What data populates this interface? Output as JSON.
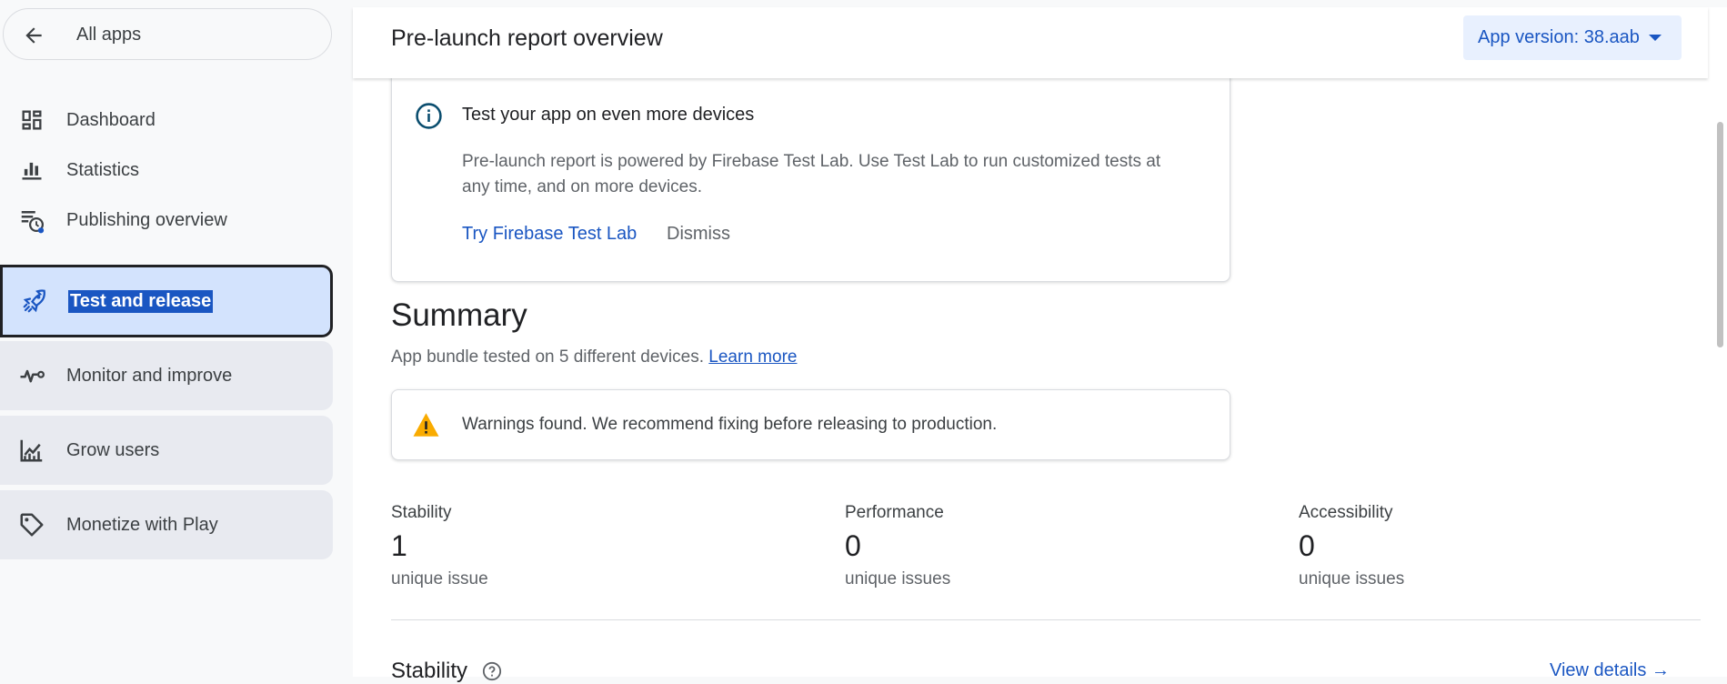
{
  "sidebar": {
    "back_label": "All apps",
    "items": [
      {
        "label": "Dashboard",
        "icon": "dashboard-icon"
      },
      {
        "label": "Statistics",
        "icon": "bar-chart-icon"
      },
      {
        "label": "Publishing overview",
        "icon": "publishing-overview-icon"
      },
      {
        "label": "Test and release",
        "icon": "rocket-icon",
        "active": true
      },
      {
        "label": "Monitor and improve",
        "icon": "vitals-icon"
      },
      {
        "label": "Grow users",
        "icon": "grow-users-icon"
      },
      {
        "label": "Monetize with Play",
        "icon": "tag-icon"
      }
    ]
  },
  "header": {
    "title": "Pre-launch report overview",
    "version_label": "App version: 38.aab"
  },
  "info_card": {
    "title": "Test your app on even more devices",
    "body": "Pre-launch report is powered by Firebase Test Lab. Use Test Lab to run customized tests at any time, and on more devices.",
    "primary_action": "Try Firebase Test Lab",
    "secondary_action": "Dismiss"
  },
  "summary": {
    "heading": "Summary",
    "subtitle": "App bundle tested on 5 different devices.",
    "learn_more": "Learn more",
    "warning": "Warnings found. We recommend fixing before releasing to production.",
    "metrics": [
      {
        "label": "Stability",
        "value": "1",
        "unit": "unique issue"
      },
      {
        "label": "Performance",
        "value": "0",
        "unit": "unique issues"
      },
      {
        "label": "Accessibility",
        "value": "0",
        "unit": "unique issues"
      }
    ]
  },
  "stability": {
    "heading": "Stability",
    "view_details": "View details"
  },
  "colors": {
    "accent": "#1a56c2",
    "active_nav_bg": "#d3e3fd",
    "warning": "#f9ab00",
    "info_icon": "#0b4e6f"
  }
}
